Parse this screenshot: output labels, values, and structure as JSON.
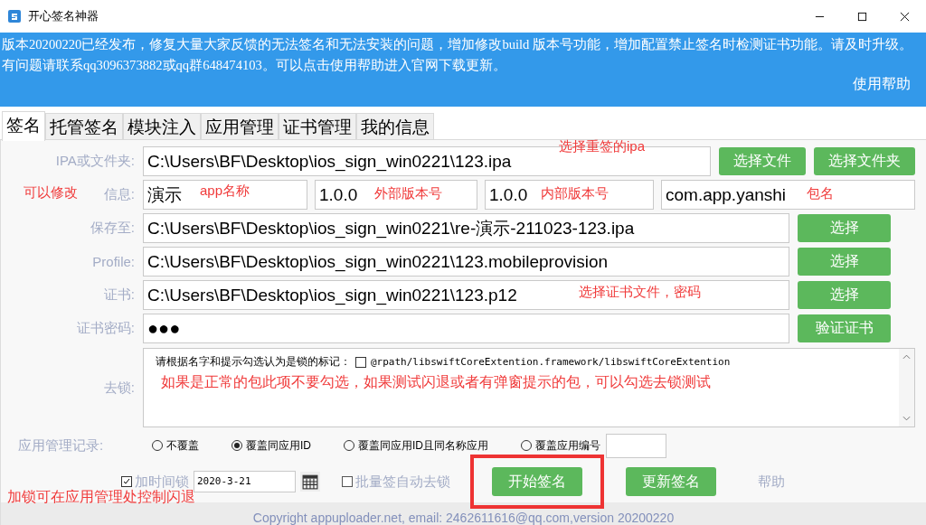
{
  "window": {
    "title": "开心签名神器"
  },
  "banner": {
    "text": "版本20200220已经发布，修复大量大家反馈的无法签名和无法安装的问题，增加修改build 版本号功能，增加配置禁止签名时检测证书功能。请及时升级。有问题请联系qq3096373882或qq群648474103。可以点击使用帮助进入官网下载更新。",
    "help_link": "使用帮助"
  },
  "tabs": [
    {
      "label": "签名",
      "selected": true
    },
    {
      "label": "托管签名",
      "selected": false
    },
    {
      "label": "模块注入",
      "selected": false
    },
    {
      "label": "应用管理",
      "selected": false
    },
    {
      "label": "证书管理",
      "selected": false
    },
    {
      "label": "我的信息",
      "selected": false
    }
  ],
  "ipa_row": {
    "label": "IPA或文件夹:",
    "value": "C:\\Users\\BF\\Desktop\\ios_sign_win0221\\123.ipa",
    "buttons": [
      "选择文件",
      "选择文件夹"
    ]
  },
  "info_row": {
    "label": "信息:",
    "fields": [
      "演示",
      "1.0.0",
      "1.0.0",
      "com.app.yanshi"
    ]
  },
  "path_rows": [
    {
      "label": "保存至:",
      "value": "C:\\Users\\BF\\Desktop\\ios_sign_win0221\\re-演示-211023-123.ipa",
      "button": "选择"
    },
    {
      "label": "Profile:",
      "value": "C:\\Users\\BF\\Desktop\\ios_sign_win0221\\123.mobileprovision",
      "button": "选择"
    },
    {
      "label": "证书:",
      "value": "C:\\Users\\BF\\Desktop\\ios_sign_win0221\\123.p12",
      "button": "选择"
    }
  ],
  "password_row": {
    "label": "证书密码:",
    "value": "●●●",
    "button": "验证证书"
  },
  "unlock": {
    "label": "去锁:",
    "prompt": "请根据名字和提示勾选认为是锁的标记：",
    "items": [
      {
        "label": "@rpath/libswiftCoreExtention.framework/libswiftCoreExtention",
        "checked": false
      }
    ]
  },
  "record": {
    "label": "应用管理记录:",
    "options": [
      {
        "label": "不覆盖",
        "selected": false
      },
      {
        "label": "覆盖同应用ID",
        "selected": true
      },
      {
        "label": "覆盖同应用ID且同名称应用",
        "selected": false
      },
      {
        "label": "覆盖应用编号",
        "selected": false
      }
    ]
  },
  "time_lock": {
    "label": "加时间锁",
    "checked": true,
    "date": "2020-3-21"
  },
  "batch_unlock": {
    "label": "批量签自动去锁",
    "checked": false
  },
  "start_button": {
    "label": "开始签名",
    "highlighted": true
  },
  "update_button": "更新签名",
  "help_link": "帮助",
  "footer": "Copyright appuploader.net, email: 2462611616@qq.com,version 20200220",
  "annotations": [
    "选择重签的ipa",
    "可以修改",
    "app名称",
    "外部版本号",
    "内部版本号",
    "包名",
    "选择证书文件，密码",
    "如果是正常的包此项不要勾选，如果测试闪退或者有弹窗提示的包，可以勾选去锁测试",
    "加锁可在应用管理处控制闪退"
  ]
}
